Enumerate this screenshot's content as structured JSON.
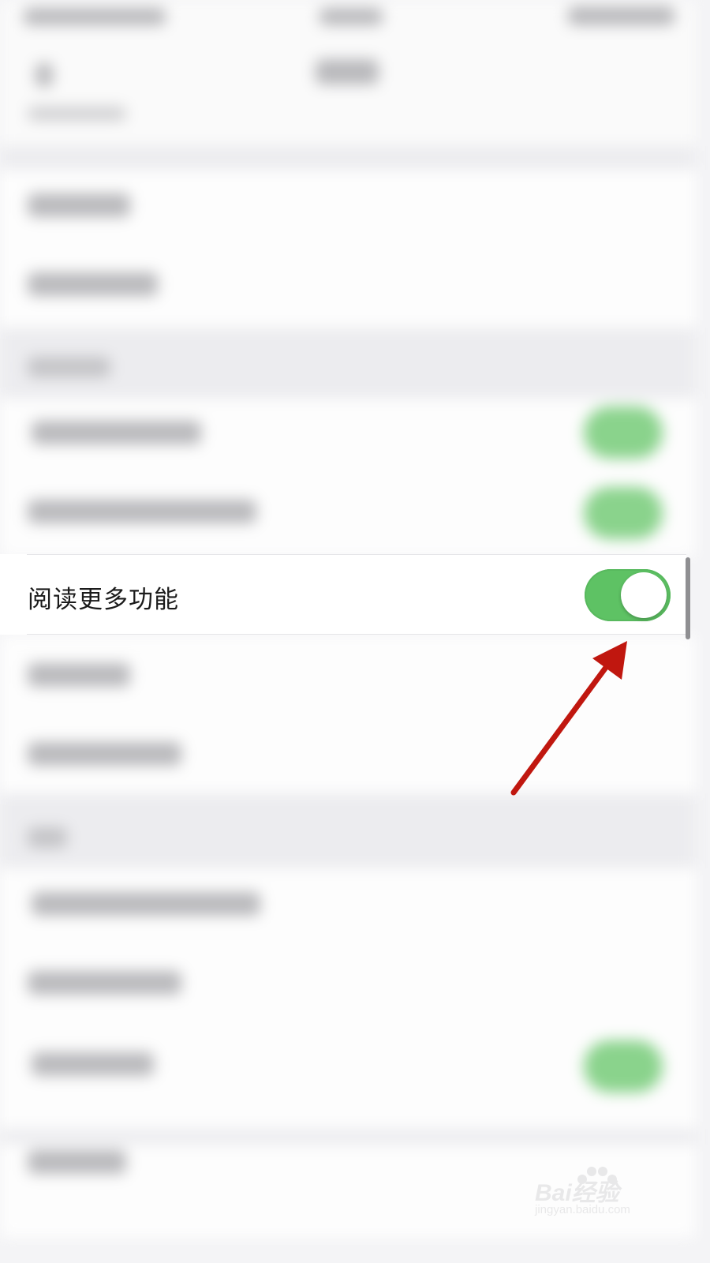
{
  "setting": {
    "label": "阅读更多功能",
    "toggle_on": true,
    "toggle_color": "#5ec264"
  },
  "annotation": {
    "arrow_color": "#c0170f",
    "icon": "arrow-pointing-to-toggle"
  },
  "watermark": {
    "brand": "Bai经验",
    "url": "jingyan.baidu.com"
  }
}
